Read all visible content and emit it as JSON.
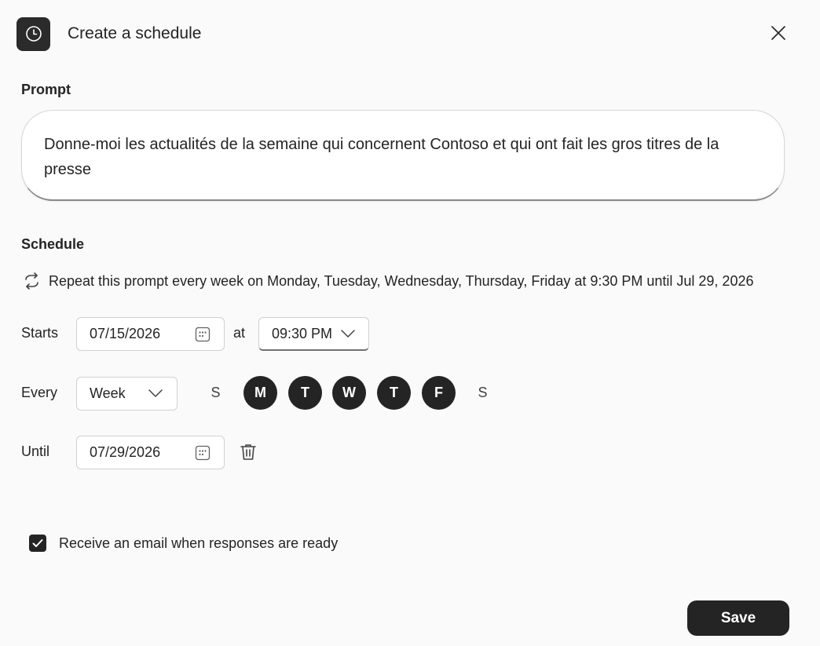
{
  "dialog": {
    "title": "Create a schedule",
    "icon": "clock-icon",
    "close_icon": "close-icon"
  },
  "prompt": {
    "label": "Prompt",
    "value": "Donne-moi les actualités de la semaine qui concernent Contoso et qui ont fait les gros titres de la presse"
  },
  "schedule": {
    "label": "Schedule",
    "summary": "Repeat this prompt every week on Monday, Tuesday, Wednesday, Thursday, Friday at 9:30 PM until Jul 29, 2026",
    "summary_icon": "repeat-icon",
    "starts": {
      "label": "Starts",
      "date": "07/15/2026",
      "at_label": "at",
      "time": "09:30 PM"
    },
    "every": {
      "label": "Every",
      "frequency": "Week",
      "days": [
        {
          "letter": "S",
          "selected": false
        },
        {
          "letter": "M",
          "selected": true
        },
        {
          "letter": "T",
          "selected": true
        },
        {
          "letter": "W",
          "selected": true
        },
        {
          "letter": "T",
          "selected": true
        },
        {
          "letter": "F",
          "selected": true
        },
        {
          "letter": "S",
          "selected": false
        }
      ]
    },
    "until": {
      "label": "Until",
      "date": "07/29/2026"
    }
  },
  "email_option": {
    "label": "Receive an email when responses are ready",
    "checked": true
  },
  "actions": {
    "save_label": "Save"
  },
  "colors": {
    "accent": "#242424",
    "background": "#fafafa"
  }
}
